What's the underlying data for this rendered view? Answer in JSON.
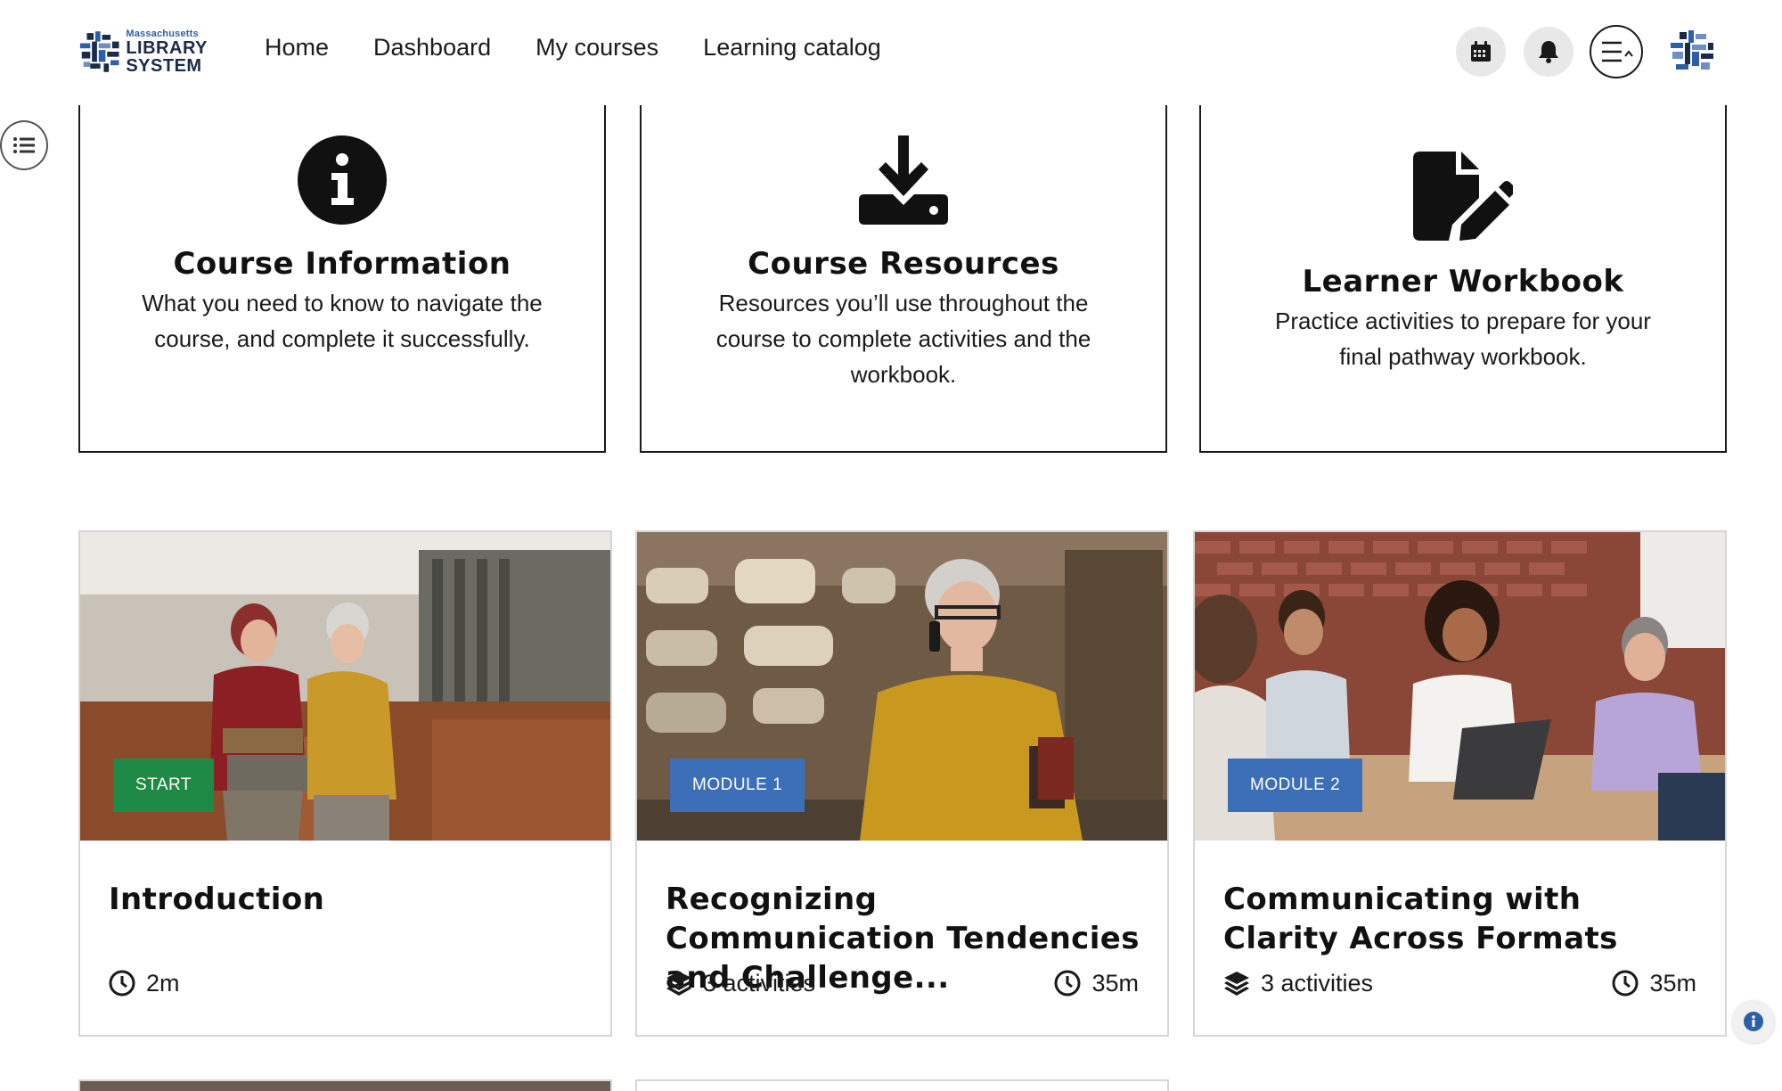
{
  "header": {
    "logo": {
      "small_text": "Massachusetts",
      "line1": "LIBRARY",
      "line2": "SYSTEM"
    },
    "nav": [
      {
        "label": "Home"
      },
      {
        "label": "Dashboard"
      },
      {
        "label": "My courses"
      },
      {
        "label": "Learning catalog"
      }
    ],
    "icons": {
      "calendar": "calendar-icon",
      "notifications": "bell-icon",
      "menu": "menu-lines-icon",
      "avatar": "user-avatar"
    }
  },
  "info_cards": [
    {
      "icon": "info-circle-icon",
      "title": "Course Information",
      "description": "What you need to know to navigate the course, and complete it successfully."
    },
    {
      "icon": "download-icon",
      "title": "Course Resources",
      "description": "Resources you’ll use throughout the course to complete activities and the workbook."
    },
    {
      "icon": "file-pen-icon",
      "title": "Learner Workbook",
      "description": "Practice activities to prepare for your final pathway workbook."
    }
  ],
  "module_cards": [
    {
      "badge": "START",
      "badge_color": "#1e8a45",
      "title": "Introduction",
      "activities": "",
      "duration": "2m"
    },
    {
      "badge": "MODULE 1",
      "badge_color": "#3c6fb7",
      "title": "Recognizing Communication Tendencies and Challenge...",
      "activities": "3 activities",
      "duration": "35m"
    },
    {
      "badge": "MODULE 2",
      "badge_color": "#3c6fb7",
      "title": "Communicating with Clarity Across Formats",
      "activities": "3 activities",
      "duration": "35m"
    }
  ],
  "colors": {
    "badge_green": "#1e8a45",
    "badge_blue": "#3c6fb7",
    "text": "#1a1a1a",
    "card_border": "#d6d6d6"
  }
}
